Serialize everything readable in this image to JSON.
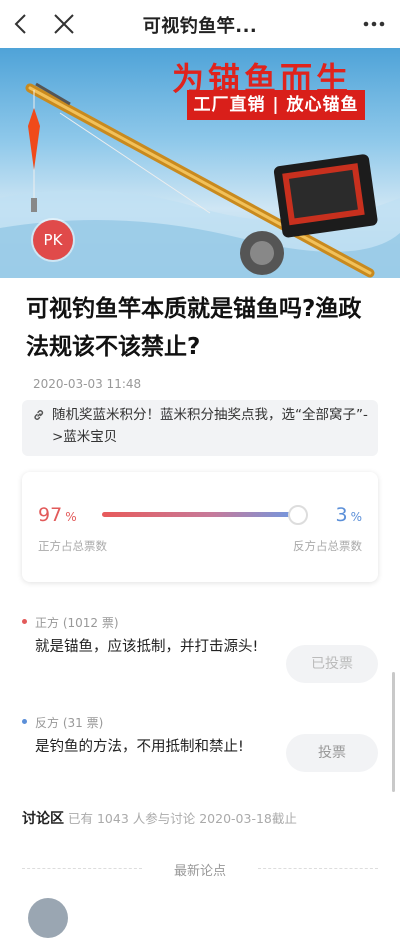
{
  "nav": {
    "title": "可视钓鱼竿..."
  },
  "banner": {
    "red_title": "为锚鱼而生",
    "slogan": "工厂直销 | 放心锚鱼",
    "pk_badge": "PK"
  },
  "article": {
    "headline": "可视钓鱼竿本质就是锚鱼吗?渔政法规该不该禁止?",
    "date": "2020-03-03 11:48",
    "notice": "随机奖蓝米积分！蓝米积分抽奖点我，选“全部窝子”->蓝米宝贝"
  },
  "vote": {
    "left_pct": "97",
    "right_pct": "3",
    "pct_unit": "%",
    "left_caption": "正方占总票数",
    "right_caption": "反方占总票数",
    "left_share": 0.97,
    "colors": {
      "pro": "#e25a5a",
      "con": "#5b8fd8"
    }
  },
  "sides": [
    {
      "label": "正方 (1012 票)",
      "text": "就是锚鱼，应该抵制，并打击源头!",
      "button": "已投票"
    },
    {
      "label": "反方 (31 票)",
      "text": "是钓鱼的方法，不用抵制和禁止!",
      "button": "投票"
    }
  ],
  "discussion": {
    "title": "讨论区",
    "meta": "已有 1043 人参与讨论 2020-03-18截止",
    "latest": "最新论点"
  }
}
